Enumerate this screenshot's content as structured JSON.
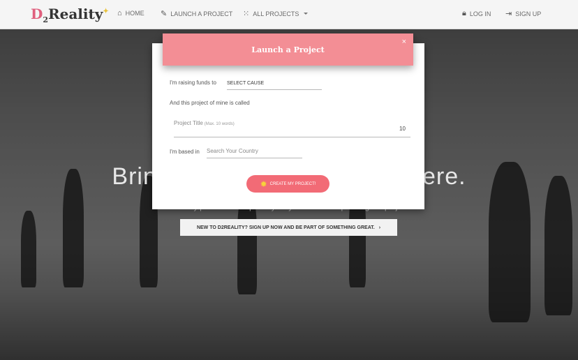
{
  "navbar": {
    "logo": {
      "d": "D",
      "two": "2",
      "reality": "Reality",
      "spark": "✦"
    },
    "home": "HOME",
    "launch": "LAUNCH A PROJECT",
    "all_projects": "ALL PROJECTS",
    "login": "LOG IN",
    "signup": "SIGN UP"
  },
  "hero": {
    "title": "Bring your dream projects here.",
    "subtitle": "D2Reality provides a simple way for you to become part of great projects.",
    "cta": "NEW TO D2REALITY? SIGN UP NOW AND BE PART OF SOMETHING GREAT."
  },
  "modal": {
    "title": "Launch a Project",
    "close": "×",
    "raising_label": "I'm raising funds to",
    "cause_value": "SELECT CAUSE",
    "called_label": "And this project of mine is called",
    "project_title_label": "Project Title",
    "project_title_hint": "(Max. 10 words)",
    "word_count": "10",
    "based_label": "I'm based in",
    "country_placeholder": "Search Your Country",
    "create_button": "CREATE MY PROJECT!"
  },
  "icons": {
    "home": "home-icon",
    "brush": "brush-icon",
    "grid": "grid-icon",
    "lock": "lock-icon",
    "signup": "signup-icon",
    "sun": "sun-icon"
  },
  "colors": {
    "modal_header": "#f38e95",
    "create_button": "#f26b76"
  }
}
